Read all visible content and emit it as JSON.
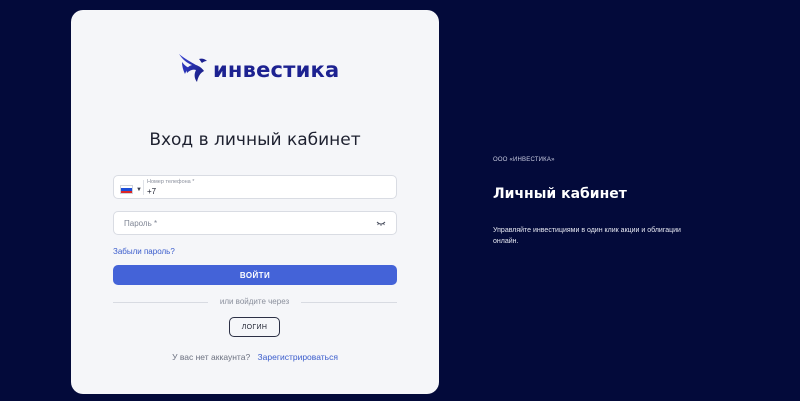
{
  "brand": {
    "logo_text": "инвестика",
    "logo_icon": "eagle-icon",
    "colors": {
      "page_background": "#030a3a",
      "card_background": "#f5f6f9",
      "accent": "#4463d8",
      "link": "#3a5ccc",
      "logo": "#1d2291"
    }
  },
  "login_form": {
    "title": "Вход в личный кабинет",
    "phone": {
      "country_flag": "russia-flag-icon",
      "label": "Номер телефона *",
      "value": "+7"
    },
    "password": {
      "placeholder": "Пароль *",
      "toggle_icon": "eye-closed-icon"
    },
    "forgot_password": "Забыли пароль?",
    "submit_label": "ВОЙТИ",
    "divider_text": "или войдите через",
    "alt_login_label": "ЛОГИН",
    "no_account_text": "У вас нет аккаунта?",
    "register_link": "Зарегистрироваться"
  },
  "info_panel": {
    "organization": "ООО «ИНВЕСТИКА»",
    "title": "Личный кабинет",
    "description": "Управляйте инвестициями в один клик акции и облигации онлайн."
  }
}
